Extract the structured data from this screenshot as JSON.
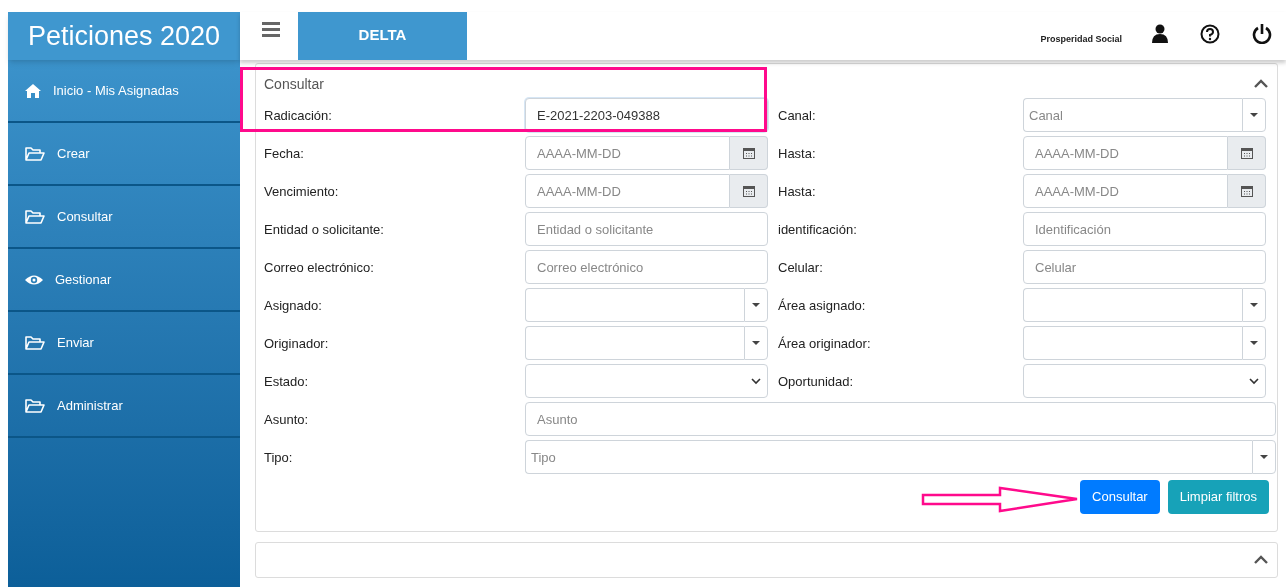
{
  "app_title": "Peticiones 2020",
  "header": {
    "tab": "DELTA",
    "organization": "Prosperidad Social"
  },
  "sidebar": {
    "items": [
      {
        "label": "Inicio - Mis Asignadas"
      },
      {
        "label": "Crear"
      },
      {
        "label": "Consultar"
      },
      {
        "label": "Gestionar"
      },
      {
        "label": "Enviar"
      },
      {
        "label": "Administrar"
      }
    ]
  },
  "search_panel": {
    "title": "Consultar",
    "expanded": true,
    "rows": [
      {
        "fields": [
          {
            "label": "Radicación:",
            "kind": "text",
            "value": "E-2021-2203-049388",
            "focused": true
          },
          {
            "label": "Canal:",
            "kind": "combo",
            "placeholder": "Canal"
          }
        ]
      },
      {
        "fields": [
          {
            "label": "Fecha:",
            "kind": "date",
            "placeholder": "AAAA-MM-DD"
          },
          {
            "label": "Hasta:",
            "kind": "date",
            "placeholder": "AAAA-MM-DD"
          }
        ]
      },
      {
        "fields": [
          {
            "label": "Vencimiento:",
            "kind": "date",
            "placeholder": "AAAA-MM-DD"
          },
          {
            "label": "Hasta:",
            "kind": "date",
            "placeholder": "AAAA-MM-DD"
          }
        ]
      },
      {
        "fields": [
          {
            "label": "Entidad o solicitante:",
            "kind": "text",
            "placeholder": "Entidad o solicitante"
          },
          {
            "label": "identificación:",
            "kind": "text",
            "placeholder": "Identificación"
          }
        ]
      },
      {
        "fields": [
          {
            "label": "Correo electrónico:",
            "kind": "text",
            "placeholder": "Correo electrónico"
          },
          {
            "label": "Celular:",
            "kind": "text",
            "placeholder": "Celular"
          }
        ]
      },
      {
        "fields": [
          {
            "label": "Asignado:",
            "kind": "combo"
          },
          {
            "label": "Área asignado:",
            "kind": "combo"
          }
        ]
      },
      {
        "fields": [
          {
            "label": "Originador:",
            "kind": "combo"
          },
          {
            "label": "Área originador:",
            "kind": "combo"
          }
        ]
      },
      {
        "fields": [
          {
            "label": "Estado:",
            "kind": "select"
          },
          {
            "label": "Oportunidad:",
            "kind": "select"
          }
        ]
      },
      {
        "fields": [
          {
            "label": "Asunto:",
            "kind": "text",
            "placeholder": "Asunto"
          }
        ]
      },
      {
        "fields": [
          {
            "label": "Tipo:",
            "kind": "combo",
            "placeholder": "Tipo"
          }
        ]
      }
    ],
    "buttons": [
      {
        "label": "Consultar",
        "kind": "primary"
      },
      {
        "label": "Limpiar filtros",
        "kind": "info"
      }
    ]
  },
  "results_panel": {
    "expanded": true
  }
}
